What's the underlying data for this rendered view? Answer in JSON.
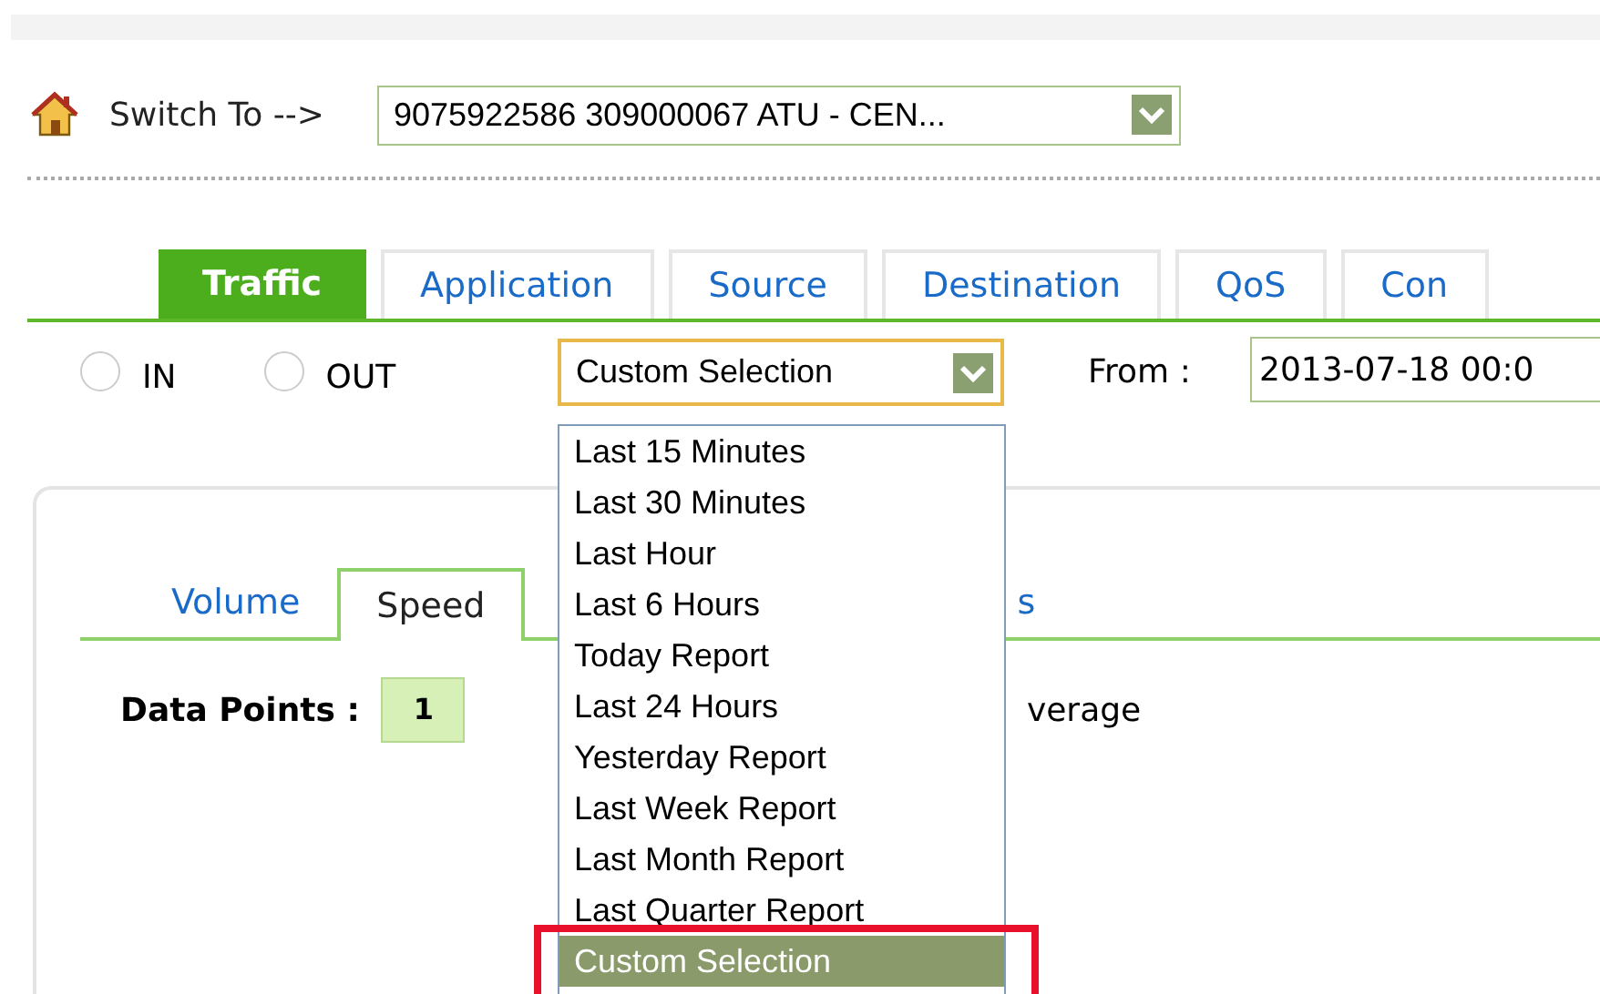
{
  "switch_to": {
    "label": "Switch To -->",
    "value": "9075922586 309000067 ATU - CEN..."
  },
  "tabs": [
    {
      "label": "Traffic",
      "selected": true
    },
    {
      "label": "Application",
      "selected": false
    },
    {
      "label": "Source",
      "selected": false
    },
    {
      "label": "Destination",
      "selected": false
    },
    {
      "label": "QoS",
      "selected": false
    },
    {
      "label": "Con",
      "selected": false
    }
  ],
  "direction": [
    {
      "label": "IN",
      "selected": false
    },
    {
      "label": "OUT",
      "selected": false
    }
  ],
  "period": {
    "value": "Custom Selection",
    "expanded": true,
    "options": [
      {
        "label": "Last 15 Minutes",
        "selected": false
      },
      {
        "label": "Last 30 Minutes",
        "selected": false
      },
      {
        "label": "Last Hour",
        "selected": false
      },
      {
        "label": "Last 6 Hours",
        "selected": false
      },
      {
        "label": "Today Report",
        "selected": false
      },
      {
        "label": "Last 24 Hours",
        "selected": false
      },
      {
        "label": "Yesterday Report",
        "selected": false
      },
      {
        "label": "Last Week Report",
        "selected": false
      },
      {
        "label": "Last Month Report",
        "selected": false
      },
      {
        "label": "Last Quarter Report",
        "selected": false
      },
      {
        "label": "Custom Selection",
        "selected": true
      }
    ]
  },
  "from": {
    "label": "From :",
    "value": "2013-07-18 00:0"
  },
  "subtabs": [
    {
      "label": "Volume",
      "selected": false
    },
    {
      "label": "Speed",
      "selected": true
    },
    {
      "label": "s",
      "selected": false
    }
  ],
  "data_points": {
    "label": "Data Points :",
    "value": "1",
    "mode": "verage"
  }
}
